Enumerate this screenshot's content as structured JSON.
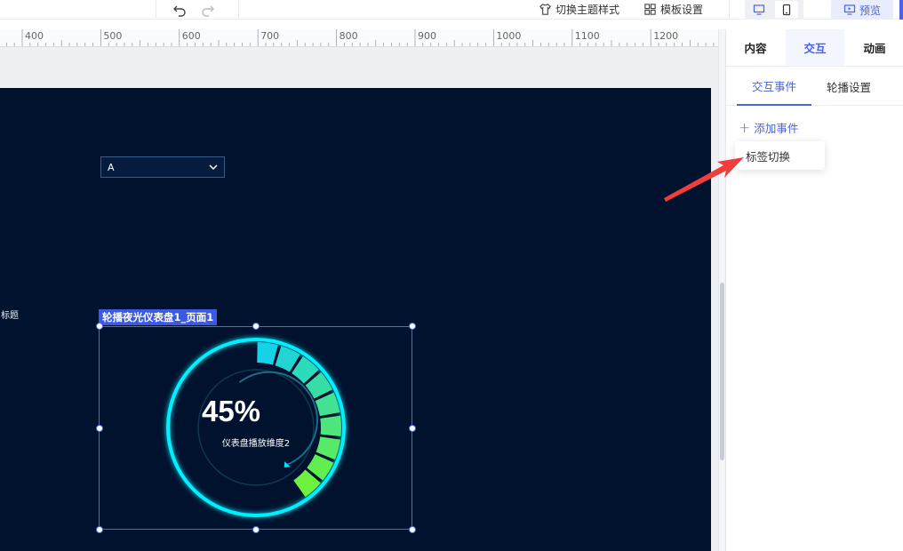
{
  "toolbar": {
    "undo_icon": "undo-icon",
    "redo_icon": "redo-icon",
    "theme_label": "切换主题样式",
    "template_label": "模板设置",
    "preview_label": "预览",
    "accent": "#4a62e8"
  },
  "ruler": {
    "marks": [
      "400",
      "500",
      "600",
      "700",
      "800",
      "900",
      "1000",
      "1100",
      "1200"
    ]
  },
  "stage": {
    "dropdown_value": "A",
    "side_title": "标题",
    "background": "#00122e"
  },
  "widget": {
    "label": "轮播夜光仪表盘1_页面1",
    "value": "45%",
    "subtitle": "仪表盘播放维度2",
    "progress": 0.45,
    "ring_color": "#00f0ff",
    "gradient_start": "#16d2e6",
    "gradient_end": "#6cf23c"
  },
  "panel": {
    "tabs": [
      "内容",
      "交互",
      "动画"
    ],
    "active_tab": "交互",
    "subtabs": [
      "交互事件",
      "轮播设置"
    ],
    "active_subtab": "交互事件",
    "add_event_label": "添加事件",
    "menu_items": [
      "标签切换"
    ]
  },
  "annotation": {
    "arrow_color": "#f23d3d"
  }
}
